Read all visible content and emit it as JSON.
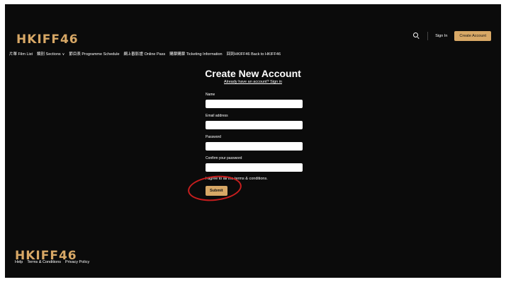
{
  "brand": {
    "logo_text": "HKIFF46"
  },
  "header": {
    "nav_items": [
      {
        "label": "片單 Film List"
      },
      {
        "label": "類別 Sections",
        "has_dropdown": true
      },
      {
        "label": "節目表 Programme Schedule"
      },
      {
        "label": "網上觀影證 Online Pass"
      },
      {
        "label": "購票購票 Ticketing Information"
      },
      {
        "label": "回到HKIFF46 Back to HKIFF46"
      }
    ],
    "search_icon": "search-icon",
    "sign_in_label": "Sign In",
    "create_account_label": "Create Account"
  },
  "main": {
    "title": "Create New Account",
    "already_link": "Already have an account? Sign in",
    "fields": [
      {
        "label": "Name",
        "value": ""
      },
      {
        "label": "Email address",
        "value": ""
      },
      {
        "label": "Password",
        "value": ""
      },
      {
        "label": "Confirm your password",
        "value": ""
      }
    ],
    "agree_text": "I agree to all the terms & conditions.",
    "submit_label": "Submit"
  },
  "footer": {
    "logo_text": "HKIFF46",
    "links": [
      {
        "label": "Help"
      },
      {
        "label": "Terms & Conditions"
      },
      {
        "label": "Privacy Policy"
      }
    ]
  },
  "colors": {
    "background": "#0b0b0b",
    "accent": "#d8a866",
    "annotation": "#c81e1e"
  }
}
